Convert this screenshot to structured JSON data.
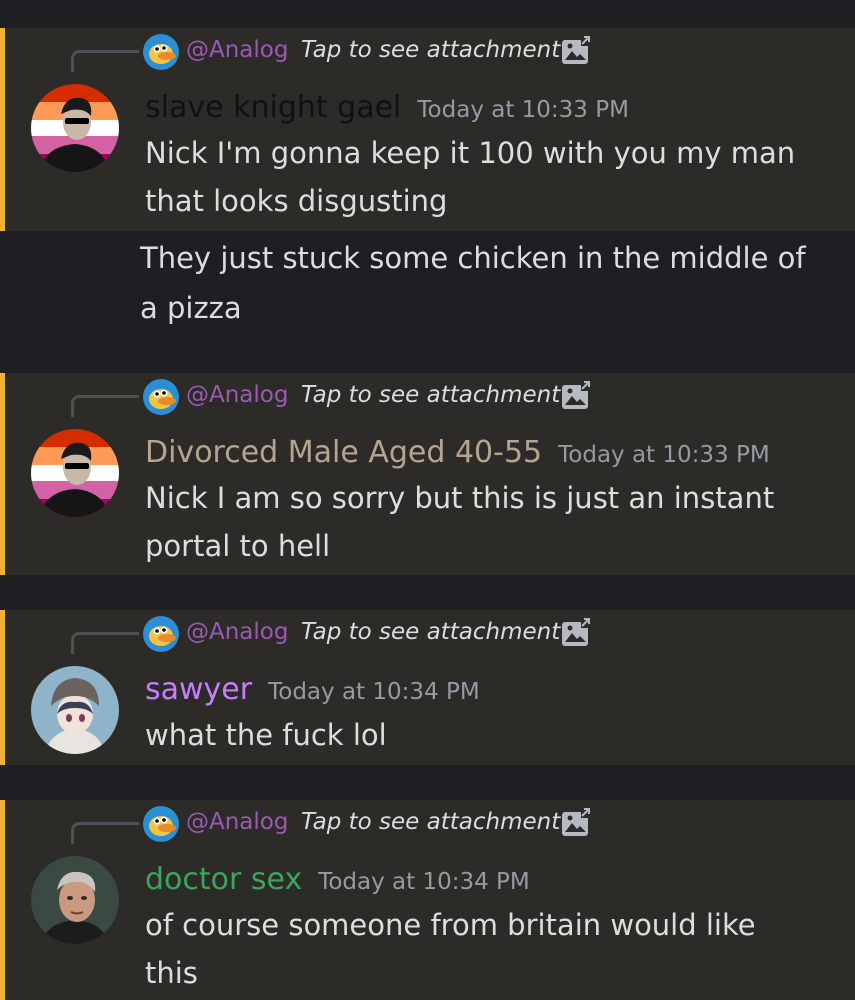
{
  "colors": {
    "background": "#1e1f22",
    "highlight_background": "#2c2b27",
    "mention_bar": "#f0b232",
    "mention_text": "#9b59b6",
    "timestamp": "#949ba4",
    "message_text": "#dbdee1"
  },
  "messages": [
    {
      "reply": {
        "mention": "@Analog",
        "attachment_text": "Tap to see attachment",
        "icon": "image-icon"
      },
      "username": "slave knight gael",
      "username_color": "#111111",
      "timestamp": "Today at 10:33 PM",
      "lines": [
        "Nick I'm gonna keep it 100 with you my man",
        "that looks disgusting"
      ],
      "avatar": "person-sunglasses-pride-flag"
    },
    {
      "lines": [
        "They just stuck some chicken in the middle of",
        "a pizza"
      ]
    },
    {
      "reply": {
        "mention": "@Analog",
        "attachment_text": "Tap to see attachment",
        "icon": "image-icon"
      },
      "username": "Divorced Male Aged 40-55",
      "username_color": "#b5a58e",
      "timestamp": "Today at 10:33 PM",
      "lines": [
        "Nick I am so sorry but this is just an instant",
        "portal to hell"
      ],
      "avatar": "person-sunglasses-pride-flag"
    },
    {
      "reply": {
        "mention": "@Analog",
        "attachment_text": "Tap to see attachment",
        "icon": "image-icon"
      },
      "username": "sawyer",
      "username_color": "#c77dff",
      "timestamp": "Today at 10:34 PM",
      "lines": [
        "what the fuck lol"
      ],
      "avatar": "anime-girl-beanie"
    },
    {
      "reply": {
        "mention": "@Analog",
        "attachment_text": "Tap to see attachment",
        "icon": "image-icon"
      },
      "username": "doctor sex",
      "username_color": "#3ba55c",
      "timestamp": "Today at 10:34 PM",
      "lines": [
        "of course someone from britain would like",
        "this"
      ],
      "avatar": "grey-haired-man"
    }
  ]
}
